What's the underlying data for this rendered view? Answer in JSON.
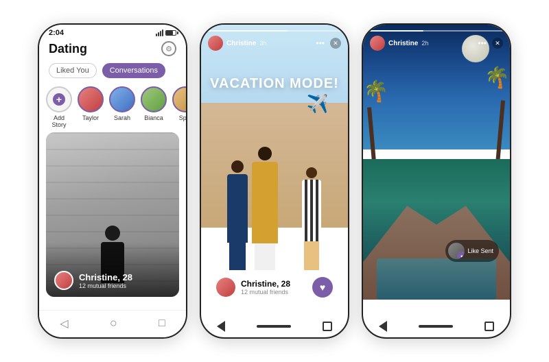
{
  "phones": {
    "left": {
      "status_time": "2:04",
      "app_title": "Dating",
      "tab_liked": "Liked You",
      "tab_conversations": "Conversations",
      "stories": [
        {
          "name": "Add Story",
          "type": "add"
        },
        {
          "name": "Taylor",
          "type": "user"
        },
        {
          "name": "Sarah",
          "type": "user"
        },
        {
          "name": "Bianca",
          "type": "user"
        },
        {
          "name": "Sp...",
          "type": "user"
        }
      ],
      "card_name": "Christine, 28",
      "card_sub": "12 mutual friends"
    },
    "center": {
      "story_user": "Christine",
      "story_time": "3h",
      "vacation_text": "VACATION MODE!",
      "airplane_emoji": "✈️",
      "card_name": "Christine, 28",
      "card_sub": "12 mutual friends",
      "more_icon": "•••",
      "close_icon": "×"
    },
    "right": {
      "story_user": "Christine",
      "story_time": "2h",
      "like_sent_text": "Like Sent",
      "more_icon": "•••",
      "close_icon": "×"
    }
  },
  "colors": {
    "purple": "#7b5ea7",
    "purple_dark": "#5a3d8a",
    "white": "#ffffff",
    "black": "#111111",
    "gray": "#888888",
    "light_gray": "#f5f5f5"
  },
  "icons": {
    "gear": "⚙",
    "plus": "+",
    "heart": "♥",
    "back": "◁",
    "home": "○",
    "recent": "□",
    "more_dots": "⋯",
    "close": "✕"
  }
}
